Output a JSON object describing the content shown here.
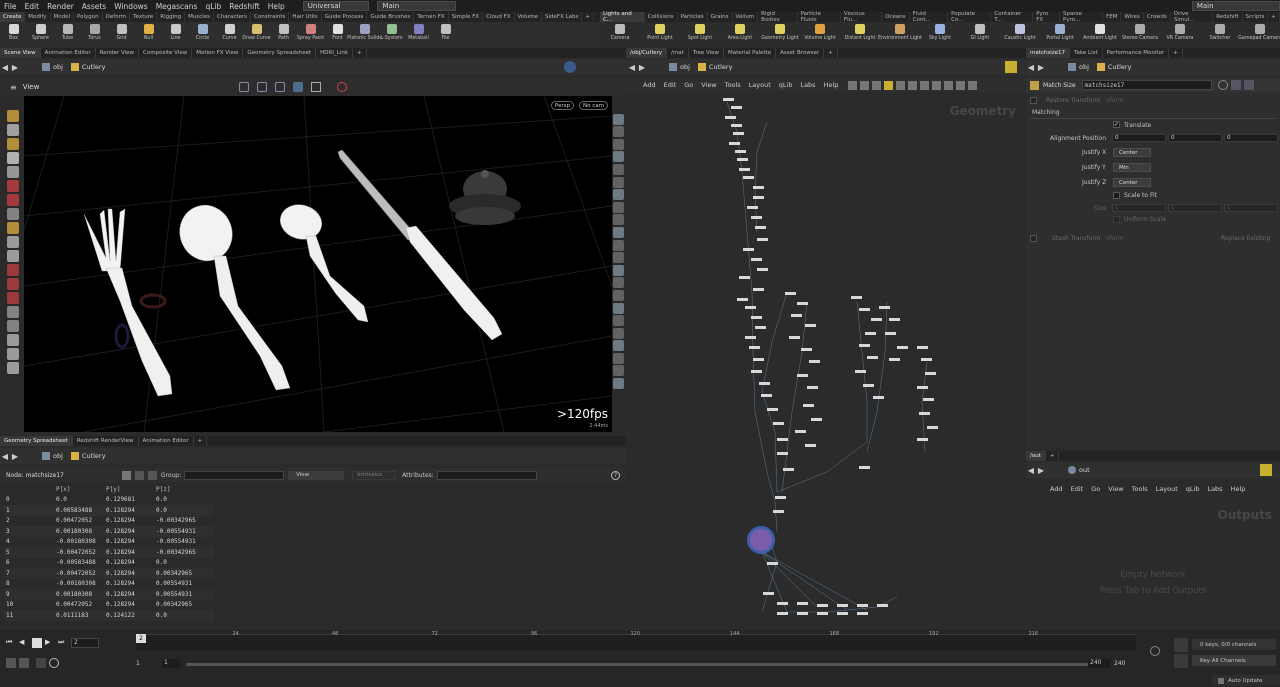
{
  "menubar": {
    "items": [
      "File",
      "Edit",
      "Render",
      "Assets",
      "Windows",
      "Megascans",
      "qLib",
      "Redshift",
      "Help"
    ],
    "desktop": "Universal",
    "scene": "Main",
    "right_scene": "Main"
  },
  "shelf_left": {
    "tabs": [
      "Create",
      "Modify",
      "Model",
      "Polygon",
      "Deform",
      "Texture",
      "Rigging",
      "Muscles",
      "Characters",
      "Constraints",
      "Hair Utils",
      "Guide Process",
      "Guide Brushes",
      "Terrain FX",
      "Simple FX",
      "Cloud FX",
      "Volume",
      "SideFX Labs"
    ],
    "tools": [
      "Box",
      "Sphere",
      "Tube",
      "Torus",
      "Grid",
      "Null",
      "Line",
      "Circle",
      "Curve",
      "Draw Curve",
      "Path",
      "Spray Paint",
      "Font",
      "Platonic Solids",
      "L-System",
      "Metaball",
      "File"
    ]
  },
  "shelf_right": {
    "tabs": [
      "Lights and C...",
      "Collisions",
      "Particles",
      "Grains",
      "Vellum",
      "Rigid Bodies",
      "Particle Fluids",
      "Viscous Flu...",
      "Oceans",
      "Fluid Cont...",
      "Populate Co...",
      "Container T...",
      "Pyro FX",
      "Sparse Pyro...",
      "FEM",
      "Wires",
      "Crowds",
      "Drive Simul...",
      "Redshift",
      "Scripts"
    ],
    "tools": [
      "Camera",
      "Point Light",
      "Spot Light",
      "Area Light",
      "Geometry Light",
      "Volume Light",
      "Distant Light",
      "Environment Light",
      "Sky Light",
      "GI Light",
      "Caustic Light",
      "Portal Light",
      "Ambient Light",
      "Stereo Camera",
      "VR Camera",
      "Switcher",
      "Gamepad Camera"
    ]
  },
  "left_tabs": [
    "Scene View",
    "Animation Editor",
    "Render View",
    "Composite View",
    "Motion FX View",
    "Geometry Spreadsheet",
    "HDRI_Link"
  ],
  "mid_tabs": [
    "/obj/Cutlery",
    "/mat",
    "Tree View",
    "Material Palette",
    "Asset Browser"
  ],
  "right_tabs": [
    "matchsize17",
    "Take List",
    "Performance Monitor"
  ],
  "path": {
    "obj": "obj",
    "node": "Cutlery"
  },
  "viewport": {
    "label": "View",
    "persp": "Persp",
    "cam": "No cam",
    "fps": ">120fps",
    "ms": "2.44ms"
  },
  "bottom_tabs": [
    "Geometry Spreadsheet",
    "Redshift RenderView",
    "Animation Editor"
  ],
  "spreadsheet": {
    "node_label": "Node: matchsize17",
    "group_label": "Group:",
    "view_label": "View",
    "intrinsics": "Intrinsics",
    "attributes_label": "Attributes:",
    "headers": [
      "",
      "P[x]",
      "P[y]",
      "P[z]"
    ],
    "rows": [
      [
        "0",
        "0.0",
        "0.129681",
        "0.0"
      ],
      [
        "1",
        "0.00583488",
        "0.128294",
        "0.0"
      ],
      [
        "2",
        "0.00472052",
        "0.128294",
        "-0.00342965"
      ],
      [
        "3",
        "0.00180308",
        "0.128294",
        "-0.00554931"
      ],
      [
        "4",
        "-0.00180308",
        "0.128294",
        "-0.00554931"
      ],
      [
        "5",
        "-0.00472052",
        "0.128294",
        "-0.00342965"
      ],
      [
        "6",
        "-0.00583488",
        "0.128294",
        "0.0"
      ],
      [
        "7",
        "-0.00472052",
        "0.128294",
        "0.00342965"
      ],
      [
        "8",
        "-0.00180308",
        "0.128294",
        "0.00554931"
      ],
      [
        "9",
        "0.00180308",
        "0.128294",
        "0.00554931"
      ],
      [
        "10",
        "0.00472052",
        "0.128294",
        "0.00342965"
      ],
      [
        "11",
        "0.0111183",
        "0.124122",
        "0.0"
      ]
    ]
  },
  "network": {
    "menu": [
      "Add",
      "Edit",
      "Go",
      "View",
      "Tools",
      "Layout",
      "qLib",
      "Labs",
      "Help"
    ],
    "context": "Geometry"
  },
  "parms": {
    "node_type": "Match Size",
    "node_name": "matchsize17",
    "restore": "Restore Transform",
    "restore_val": "xform",
    "matching": "Matching",
    "translate": "Translate",
    "align_label": "Alignment Position",
    "align": [
      "0",
      "0",
      "0"
    ],
    "jx_label": "Justify X",
    "jx": "Center",
    "jy_label": "Justify Y",
    "jy": "Min",
    "jz_label": "Justify Z",
    "jz": "Center",
    "scale_fit": "Scale to Fit",
    "size_label": "Size",
    "size": [
      "1",
      "1",
      "1"
    ],
    "uniform": "Uniform Scale",
    "stash": "Stash Transform",
    "stash_val": "xform",
    "replace": "Replace Existing"
  },
  "out_pane": {
    "path": "/out",
    "node": "out",
    "menu": [
      "Add",
      "Edit",
      "Go",
      "View",
      "Tools",
      "Layout",
      "qLib",
      "Labs",
      "Help"
    ],
    "context": "Outputs",
    "empty": "Empty Network",
    "hint": "Press Tab to Add Outputs"
  },
  "timeline": {
    "frame": "2",
    "ticks": [
      "2",
      "24",
      "48",
      "72",
      "96",
      "120",
      "144",
      "168",
      "192",
      "216"
    ],
    "start": "1",
    "start2": "1",
    "end": "240",
    "end2": "240",
    "keys": "0 keys, 0/0 channels",
    "key_all": "Key All Channels",
    "auto": "Auto Update"
  }
}
